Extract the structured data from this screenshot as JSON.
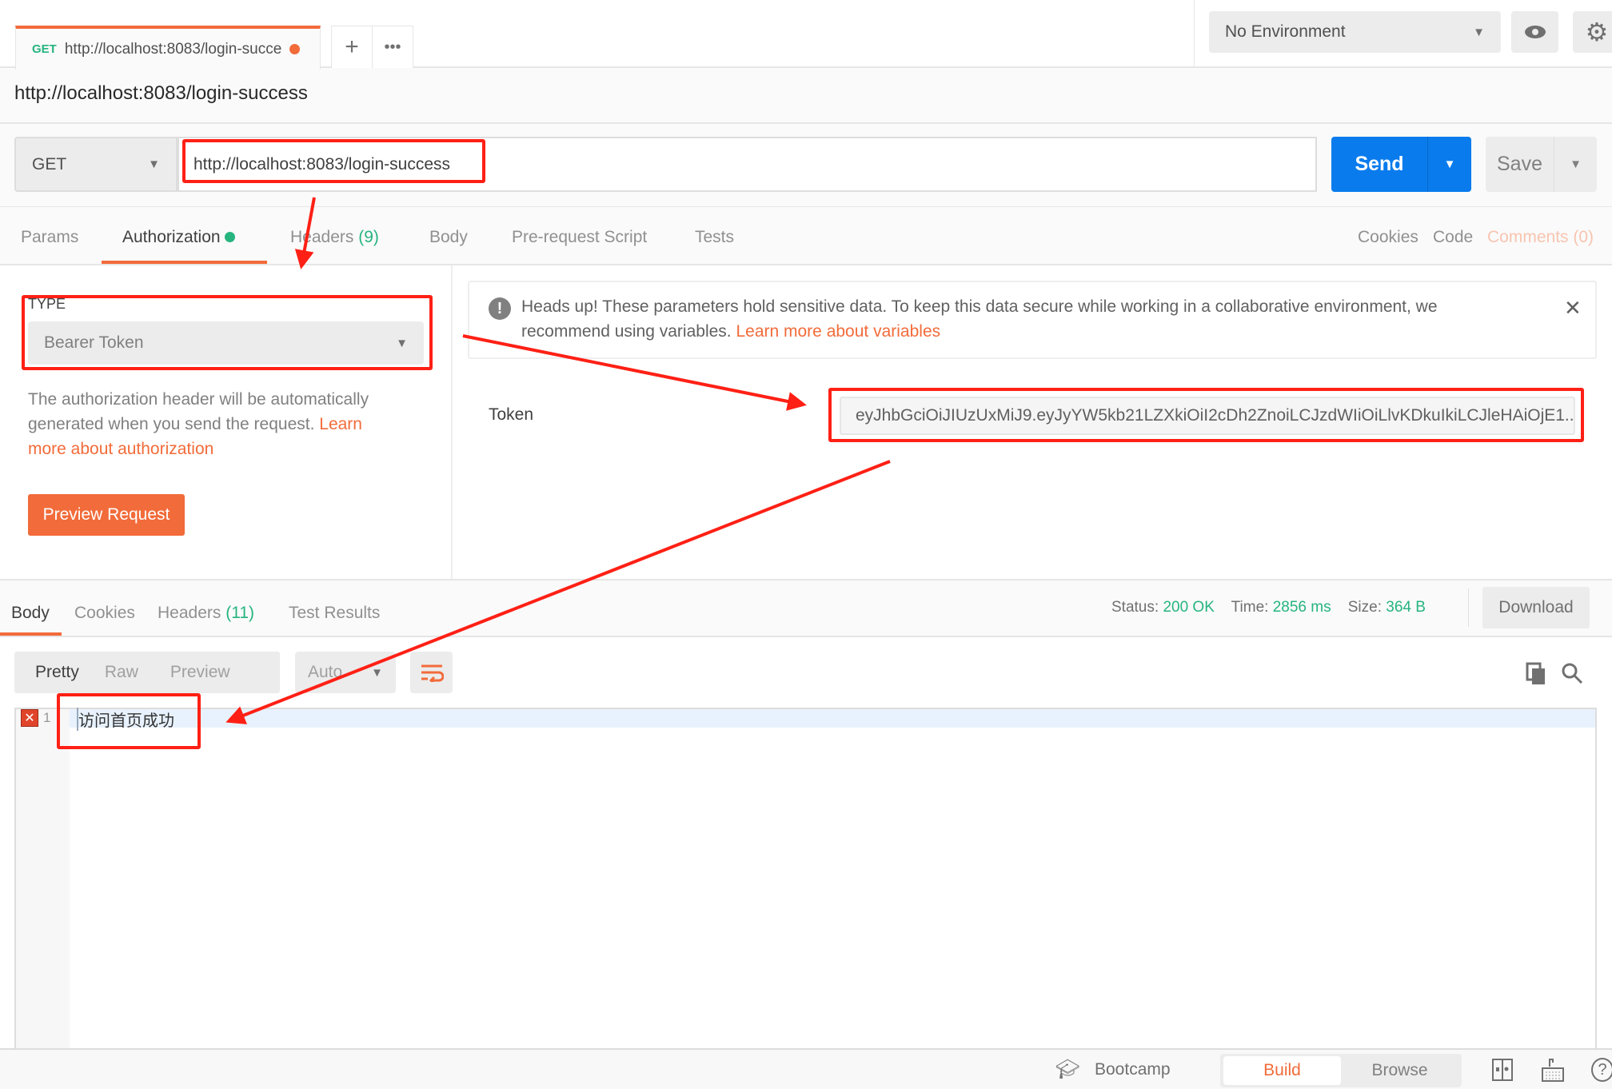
{
  "tab": {
    "method": "GET",
    "title": "http://localhost:8083/login-succe",
    "unsaved_dot_color": "#f26b3a"
  },
  "tab_actions": {
    "new": "+",
    "more": "•••"
  },
  "environment": {
    "selected": "No Environment"
  },
  "request": {
    "title": "http://localhost:8083/login-success",
    "method": "GET",
    "url": "http://localhost:8083/login-success",
    "send": "Send",
    "save": "Save"
  },
  "req_tabs": [
    {
      "label": "Params"
    },
    {
      "label": "Authorization",
      "active": true
    },
    {
      "label": "Headers",
      "count": "(9)"
    },
    {
      "label": "Body"
    },
    {
      "label": "Pre-request Script"
    },
    {
      "label": "Tests"
    }
  ],
  "req_links": {
    "cookies": "Cookies",
    "code": "Code",
    "comments": "Comments (0)"
  },
  "auth": {
    "type_label": "TYPE",
    "type": "Bearer Token",
    "desc": "The authorization header will be automatically generated when you send the request. ",
    "desc_link": "Learn more about authorization",
    "preview": "Preview Request",
    "alert": "Heads up! These parameters hold sensitive data. To keep this data secure while working in a collaborative environment, we recommend using variables. ",
    "alert_link": "Learn more about variables",
    "token_label": "Token",
    "token": "eyJhbGciOiJIUzUxMiJ9.eyJyYW5kb21LZXkiOiI2cDh2ZnoiLCJzdWIiOiLlvKDkuIkiLCJleHAiOjE1..."
  },
  "response": {
    "tabs": [
      {
        "label": "Body",
        "active": true
      },
      {
        "label": "Cookies"
      },
      {
        "label": "Headers",
        "count": "(11)"
      },
      {
        "label": "Test Results"
      }
    ],
    "status_label": "Status:",
    "status": "200 OK",
    "time_label": "Time:",
    "time": "2856 ms",
    "size_label": "Size:",
    "size": "364 B",
    "download": "Download",
    "formats": [
      "Pretty",
      "Raw",
      "Preview"
    ],
    "lang": "Auto",
    "line_number": "1",
    "body": "访问首页成功"
  },
  "footer": {
    "bootcamp": "Bootcamp",
    "build": "Build",
    "browse": "Browse"
  },
  "colors": {
    "accent": "#f26b3a",
    "send": "#097bed",
    "success": "#26b47f",
    "annotation": "#ff2015"
  }
}
